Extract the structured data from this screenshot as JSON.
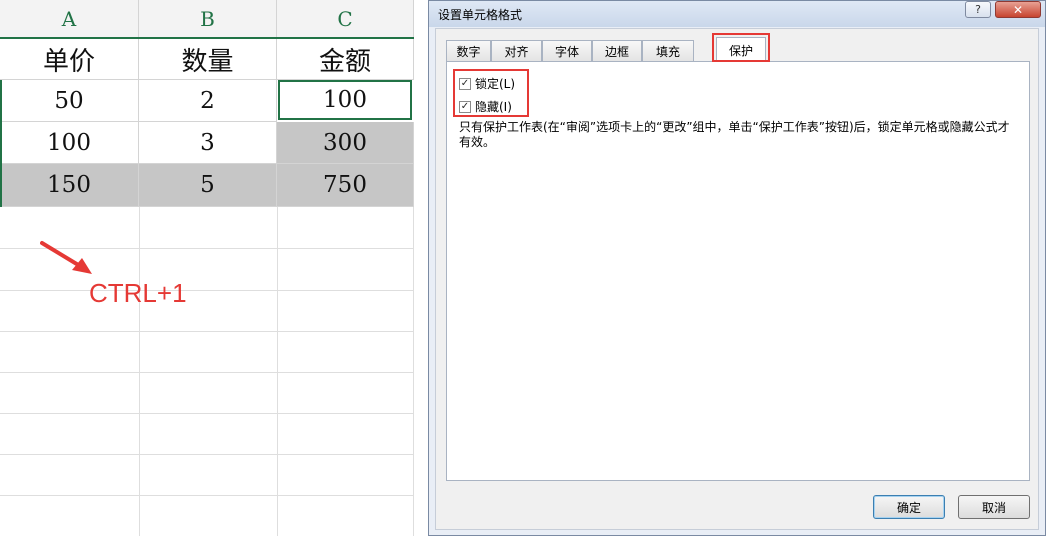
{
  "sheet": {
    "columns": [
      "A",
      "B",
      "C"
    ],
    "headers": [
      "单价",
      "数量",
      "金额"
    ],
    "rows": [
      [
        "50",
        "2",
        "100"
      ],
      [
        "100",
        "3",
        "300"
      ],
      [
        "150",
        "5",
        "750"
      ]
    ]
  },
  "annotation": {
    "shortcut": "CTRL+1",
    "color": "#e53935"
  },
  "dialog": {
    "title": "设置单元格格式",
    "help": "?",
    "close": "✕",
    "tabs": [
      "数字",
      "对齐",
      "字体",
      "边框",
      "填充",
      "保护"
    ],
    "active_tab": "保护",
    "checkboxes": [
      {
        "label": "锁定(L)",
        "checked": true
      },
      {
        "label": "隐藏(I)",
        "checked": true
      }
    ],
    "note": "只有保护工作表(在“审阅”选项卡上的“更改”组中，单击“保护工作表”按钮)后，锁定单元格或隐藏公式才有效。",
    "ok_label": "确定",
    "cancel_label": "取消"
  },
  "colors": {
    "excel_green": "#217346",
    "selection_gray": "#c6c6c6",
    "highlight_red": "#e53935"
  }
}
